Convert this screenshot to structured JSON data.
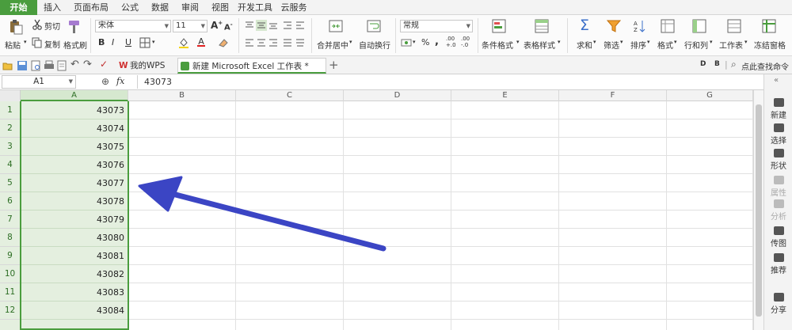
{
  "ribbon_tabs": [
    "开始",
    "插入",
    "页面布局",
    "公式",
    "数据",
    "审阅",
    "视图",
    "开发工具",
    "云服务"
  ],
  "ribbon": {
    "paste": "粘贴",
    "cut": "剪切",
    "copy": "复制",
    "format_painter": "格式刷",
    "font_name": "宋体",
    "font_size": "11",
    "merge_center": "合并居中",
    "wrap_text": "自动换行",
    "number_format": "常规",
    "conditional_format": "条件格式",
    "table_style": "表格样式",
    "sum": "求和",
    "filter": "筛选",
    "sort": "排序",
    "format": "格式",
    "rows_cols": "行和列",
    "worksheet": "工作表",
    "freeze": "冻结窗格",
    "bold": "B",
    "italic": "I",
    "underline": "U",
    "percent": "%",
    "comma": ",",
    "inc_decimal": ".00 +.0",
    "dec_decimal": ".00 -.0"
  },
  "doc_tabs": [
    {
      "label": "我的WPS",
      "active": false
    },
    {
      "label": "新建 Microsoft Excel 工作表 *",
      "active": true
    }
  ],
  "find_command": "点此查找命令",
  "name_box": "A1",
  "fx_label": "fx",
  "formula_value": "43073",
  "columns": [
    "A",
    "B",
    "C",
    "D",
    "E",
    "F",
    "G"
  ],
  "rows": [
    {
      "num": "1",
      "a": "43073"
    },
    {
      "num": "2",
      "a": "43074"
    },
    {
      "num": "3",
      "a": "43075"
    },
    {
      "num": "4",
      "a": "43076"
    },
    {
      "num": "5",
      "a": "43077"
    },
    {
      "num": "6",
      "a": "43078"
    },
    {
      "num": "7",
      "a": "43079"
    },
    {
      "num": "8",
      "a": "43080"
    },
    {
      "num": "9",
      "a": "43081"
    },
    {
      "num": "10",
      "a": "43082"
    },
    {
      "num": "11",
      "a": "43083"
    },
    {
      "num": "12",
      "a": "43084"
    }
  ],
  "side_panel": [
    {
      "label": "新建",
      "disabled": false
    },
    {
      "label": "选择",
      "disabled": false
    },
    {
      "label": "形状",
      "disabled": false
    },
    {
      "label": "属性",
      "disabled": true
    },
    {
      "label": "分析",
      "disabled": true
    },
    {
      "label": "传图",
      "disabled": false
    },
    {
      "label": "推荐",
      "disabled": false
    },
    {
      "label": "分享",
      "disabled": false
    }
  ],
  "colors": {
    "accent": "#4a9d3e",
    "selection_fill": "#e4efdf",
    "arrow": "#3b45c4"
  }
}
